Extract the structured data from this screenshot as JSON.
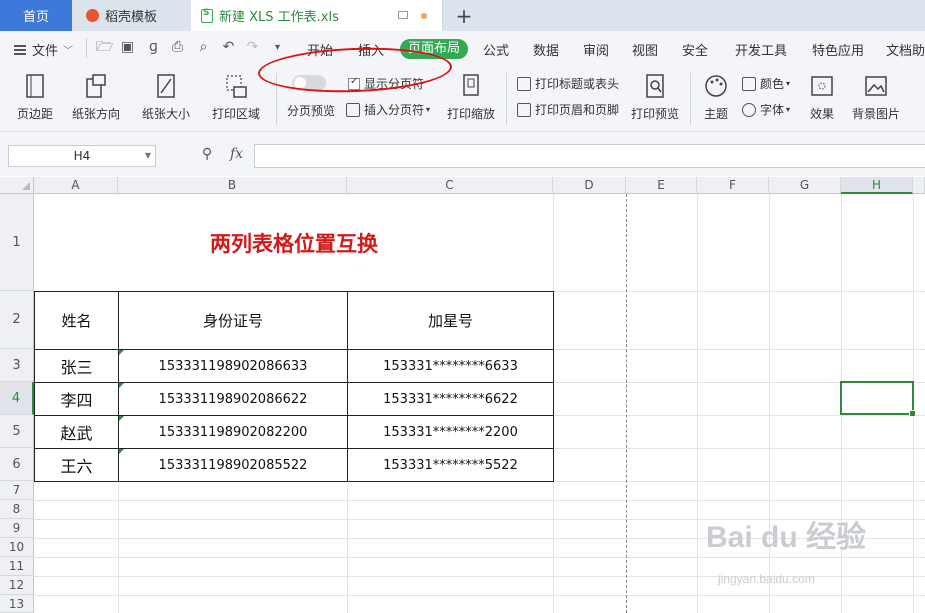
{
  "tabs": {
    "home": "首页",
    "daoke": "稻壳模板",
    "active_file": "新建 XLS 工作表.xls",
    "plus": "+"
  },
  "menu": {
    "file": "文件",
    "items": [
      "开始",
      "插入",
      "页面布局",
      "公式",
      "数据",
      "审阅",
      "视图",
      "安全",
      "开发工具",
      "特色应用",
      "文档助手"
    ],
    "active_index": 2
  },
  "ribbon": {
    "margins": "页边距",
    "orientation": "纸张方向",
    "size": "纸张大小",
    "print_area": "打印区域",
    "page_preview": "分页预览",
    "show_pagebreak": "显示分页符",
    "insert_pagebreak": "插入分页符",
    "print_scale": "打印缩放",
    "print_titles": "打印标题或表头",
    "header_footer": "打印页眉和页脚",
    "print_preview": "打印预览",
    "theme": "主题",
    "colors": "颜色",
    "fonts": "字体",
    "effects": "效果",
    "background": "背景图片"
  },
  "formula_bar": {
    "cell_ref": "H4",
    "fx": "fx",
    "value": ""
  },
  "grid": {
    "columns": [
      "A",
      "B",
      "C",
      "D",
      "E",
      "F",
      "G",
      "H"
    ],
    "selected_column": "H",
    "rows": [
      "1",
      "2",
      "3",
      "4",
      "5",
      "6",
      "7",
      "8",
      "9",
      "10",
      "11",
      "12",
      "13"
    ],
    "selected_row": "4"
  },
  "sheet": {
    "title": "两列表格位置互换",
    "headers": [
      "姓名",
      "身份证号",
      "加星号"
    ],
    "rows": [
      {
        "name": "张三",
        "id": "153331198902086633",
        "masked": "153331********6633"
      },
      {
        "name": "李四",
        "id": "153331198902086622",
        "masked": "153331********6622"
      },
      {
        "name": "赵武",
        "id": "153331198902082200",
        "masked": "153331********2200"
      },
      {
        "name": "王六",
        "id": "153331198902085522",
        "masked": "153331********5522"
      }
    ]
  },
  "watermark": {
    "brand": "Bai du 经验",
    "url": "jingyan.baidu.com"
  },
  "colors": {
    "accent_green": "#35a853",
    "title_red": "#d21a1a",
    "annotation_red": "#dd1111"
  }
}
